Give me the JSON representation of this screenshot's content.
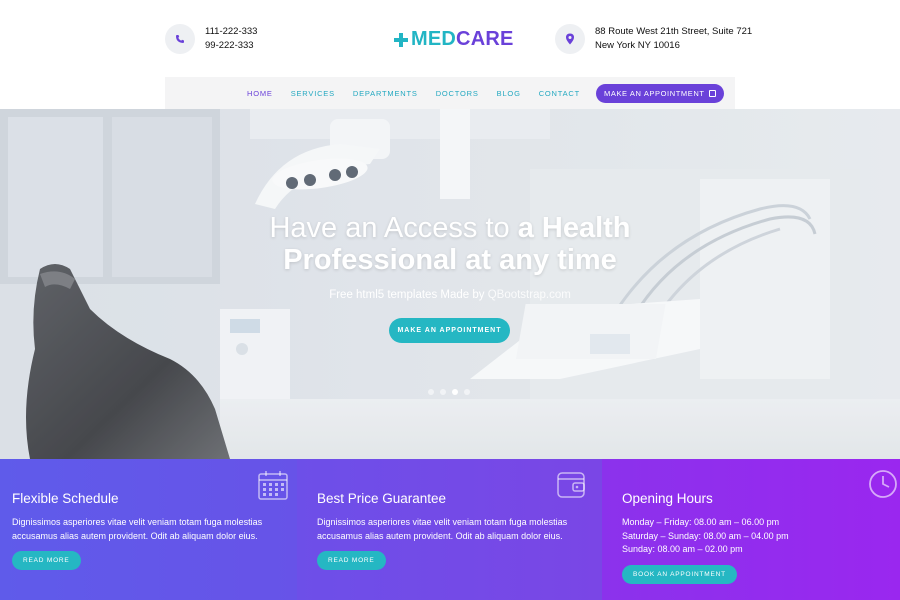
{
  "header": {
    "phone_lines": [
      "111-222-333",
      "99-222-333"
    ],
    "logo": {
      "part1": "MED",
      "part2": "CARE"
    },
    "address_lines": [
      "88 Route West 21th Street, Suite 721",
      "New York NY 10016"
    ]
  },
  "nav": {
    "items": [
      "HOME",
      "SERVICES",
      "DEPARTMENTS",
      "DOCTORS",
      "BLOG",
      "CONTACT"
    ],
    "cta_label": "MAKE AN APPOINTMENT"
  },
  "hero": {
    "title_line1_light": "Have an Access to ",
    "title_line1_bold": "a Health",
    "title_line2": "Professional at any time",
    "subtitle_prefix": "Free html5 templates Made by ",
    "subtitle_brand": "QBootstrap.com",
    "button_label": "MAKE AN APPOINTMENT",
    "slide_count": 4,
    "active_slide": 3
  },
  "features": [
    {
      "title": "Flexible Schedule",
      "text": "Dignissimos asperiores vitae velit veniam totam fuga molestias accusamus alias autem provident. Odit ab aliquam dolor eius.",
      "button_label": "READ MORE",
      "icon": "calendar-icon"
    },
    {
      "title": "Best Price Guarantee",
      "text": "Dignissimos asperiores vitae velit veniam totam fuga molestias accusamus alias autem provident. Odit ab aliquam dolor eius.",
      "button_label": "READ MORE",
      "icon": "wallet-icon"
    },
    {
      "title": "Opening Hours",
      "hours": [
        "Monday – Friday: 08.00 am – 06.00 pm",
        "Saturday – Sunday: 08.00 am – 04.00 pm",
        "Sunday: 08.00 am – 02.00 pm"
      ],
      "button_label": "BOOK AN APPOINTMENT",
      "icon": "clock-icon"
    }
  ],
  "colors": {
    "primary_purple": "#6a41d9",
    "accent_teal": "#25b7c3"
  }
}
